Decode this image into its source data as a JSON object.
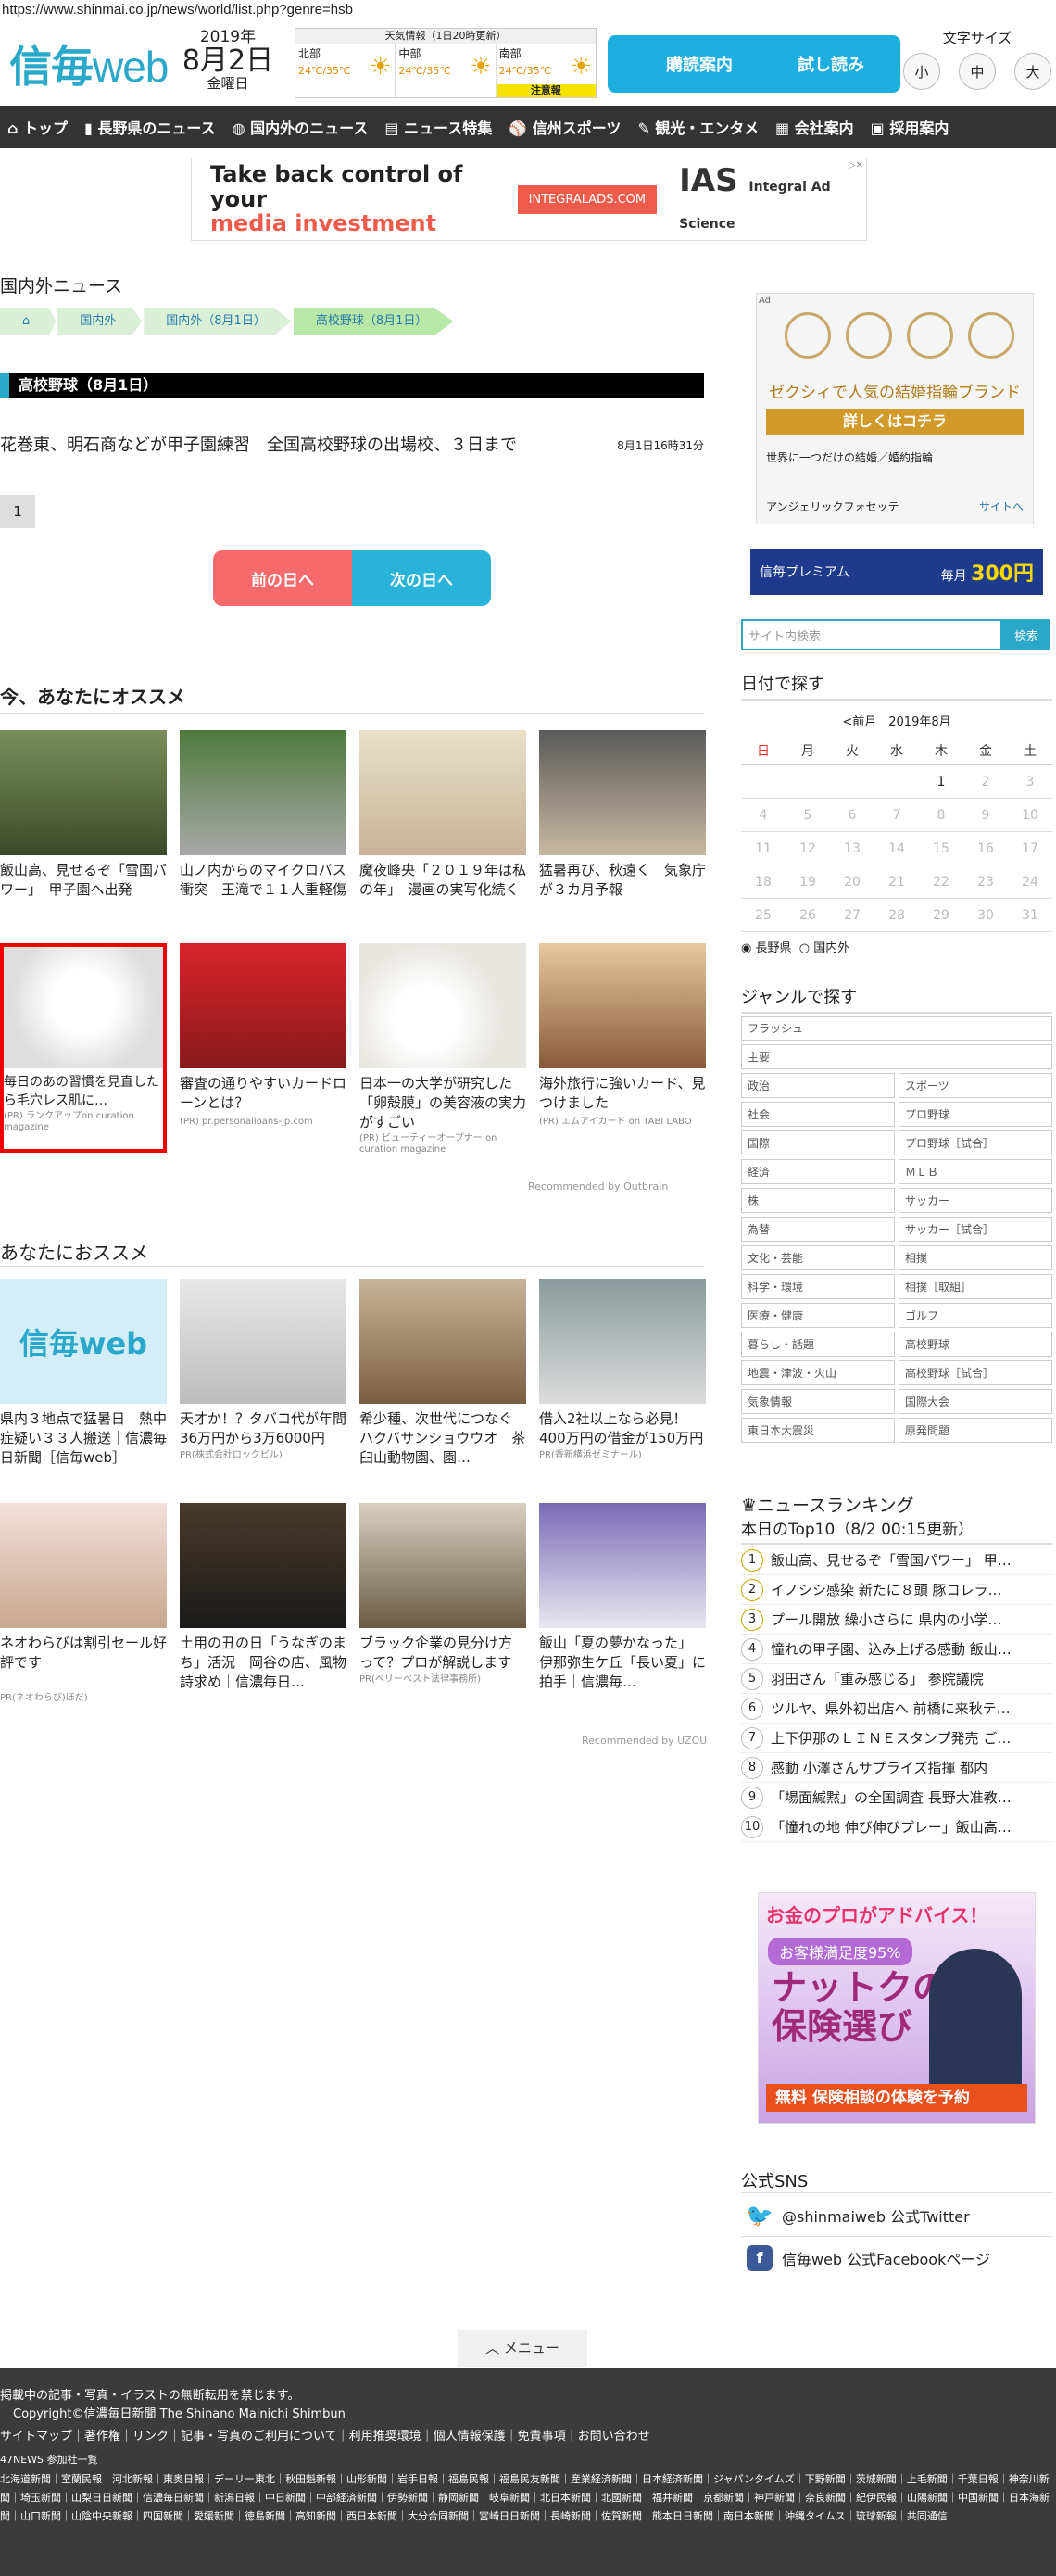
{
  "url": "https://www.shinmai.co.jp/news/world/list.php?genre=hsb",
  "header": {
    "logo_a": "信毎",
    "logo_b": "web",
    "year": "2019年",
    "day": "8月2日",
    "weekday": "金曜日",
    "weather_title": "天気情報（1日20時更新）",
    "regions": [
      {
        "name": "北部",
        "temp": "24℃/35℃"
      },
      {
        "name": "中部",
        "temp": "24℃/35℃"
      },
      {
        "name": "南部",
        "temp": "24℃/35℃"
      }
    ],
    "warn": "注意報",
    "subscribe": "購読案内",
    "trial": "試し読み",
    "fontsize_label": "文字サイズ",
    "fontsize": [
      "小",
      "中",
      "大"
    ]
  },
  "nav": [
    "トップ",
    "長野県のニュース",
    "国内外のニュース",
    "ニュース特集",
    "信州スポーツ",
    "観光・エンタメ",
    "会社案内",
    "採用案内"
  ],
  "ad_top": {
    "line1": "Take back control of your",
    "line2": "media investment",
    "btn": "INTEGRALADS.COM",
    "brand": "IAS",
    "brand_sub": "Integral Ad Science"
  },
  "section_title": "国内外ニュース",
  "breadcrumb": [
    "国内外",
    "国内外（8月1日）",
    "高校野球（8月1日）"
  ],
  "heading": "高校野球（8月1日）",
  "article": {
    "title": "花巻東、明石商などが甲子園練習　全国高校野球の出場校、３日まで",
    "date": "8月1日16時31分"
  },
  "page_num": "1",
  "prev_day": "前の日へ",
  "next_day": "次の日へ",
  "rec1_title": "今、あなたにオススメ",
  "rec1": [
    {
      "cap": "飯山高、見せるぞ「雪国パワー」　甲子園へ出発",
      "pr": ""
    },
    {
      "cap": "山ノ内からのマイクロバス衝突　王滝で１１人重軽傷",
      "pr": ""
    },
    {
      "cap": "魔夜峰央「２０１９年は私の年」　漫画の実写化続く",
      "pr": ""
    },
    {
      "cap": "猛暑再び、秋遠く　気象庁が３カ月予報",
      "pr": ""
    },
    {
      "cap": "毎日のあの習慣を見直したら毛穴レス肌に…",
      "pr": "(PR) ランクアップon curation magazine"
    },
    {
      "cap": "審査の通りやすいカードローンとは？",
      "pr": "(PR) pr.personalloans-jp.com"
    },
    {
      "cap": "日本一の大学が研究した「卵殻膜」の美容液の実力がすごい",
      "pr": "(PR) ビューティーオープナー on curation magazine"
    },
    {
      "cap": "海外旅行に強いカード、見つけました",
      "pr": "(PR) エムアイカード on TABI LABO"
    }
  ],
  "outbrain": "Recommended by Outbrain",
  "rec2_title": "あなたにおススメ",
  "rec2": [
    {
      "cap": "県内３地点で猛暑日　熱中症疑い３３人搬送｜信濃毎日新聞［信毎web］",
      "pr": ""
    },
    {
      "cap": "天才か！？タバコ代が年間36万円から3万6000円に！",
      "pr": "PR(株式会社ロックビル)"
    },
    {
      "cap": "希少種、次世代につなぐ　ハクバサンショウウオ　茶臼山動物園、園…",
      "pr": ""
    },
    {
      "cap": "借入2社以上なら必見！400万円の借金が150万円に!?",
      "pr": "PR(香新横浜ゼミナール)"
    },
    {
      "cap": "ネオわらびは割引セール好評です",
      "pr": "PR(ネオわらび)ほだ)"
    },
    {
      "cap": "土用の丑の日「うなぎのまち」活況　岡谷の店、風物詩求め｜信濃毎日…",
      "pr": ""
    },
    {
      "cap": "ブラック企業の見分け方って？プロが解説します",
      "pr": "PR(ベリーベスト法律事務所)"
    },
    {
      "cap": "飯山「夏の夢かなった」　伊那弥生ケ丘「長い夏」に拍手｜信濃毎…",
      "pr": ""
    }
  ],
  "uzou": "Recommended by UZOU",
  "side_ad": {
    "t1": "ゼクシィで人気の結婚指輪ブランド",
    "t2": "詳しくはコチラ",
    "t3": "世界に一つだけの結婚／婚約指輪",
    "t4": "アンジェリックフォセッテ",
    "t5": "サイトへ",
    "label": "Ad"
  },
  "side_ad2": {
    "l": "信毎プレミアム",
    "m": "毎月",
    "r": "300円"
  },
  "search_placeholder": "サイト内検索",
  "search_btn": "検索",
  "cal_title": "日付で探す",
  "cal_month": "<前月　2019年8月",
  "dow": [
    "日",
    "月",
    "火",
    "水",
    "木",
    "金",
    "土"
  ],
  "weeks": [
    [
      "",
      "",
      "",
      "",
      "1",
      "2",
      "3"
    ],
    [
      "4",
      "5",
      "6",
      "7",
      "8",
      "9",
      "10"
    ],
    [
      "11",
      "12",
      "13",
      "14",
      "15",
      "16",
      "17"
    ],
    [
      "18",
      "19",
      "20",
      "21",
      "22",
      "23",
      "24"
    ],
    [
      "25",
      "26",
      "27",
      "28",
      "29",
      "30",
      "31"
    ]
  ],
  "cal_radio": [
    "長野県",
    "国内外"
  ],
  "genre_title": "ジャンルで探す",
  "genres_wide": [
    "フラッシュ",
    "主要"
  ],
  "genres": [
    "政治",
    "スポーツ",
    "社会",
    "プロ野球",
    "国際",
    "プロ野球［試合］",
    "経済",
    "ＭＬＢ",
    "株",
    "サッカー",
    "為替",
    "サッカー［試合］",
    "文化・芸能",
    "相撲",
    "科学・環境",
    "相撲［取組］",
    "医療・健康",
    "ゴルフ",
    "暮らし・話題",
    "高校野球",
    "地震・津波・火山",
    "高校野球［試合］",
    "気象情報",
    "国際大会",
    "東日本大震災",
    "原発問題"
  ],
  "rank_title": "ニュースランキング",
  "rank_sub": "本日のTop10（8/2 00:15更新）",
  "ranking": [
    "飯山高、見せるぞ「雪国パワー」 甲…",
    "イノシシ感染 新たに８頭 豚コレラ…",
    "プール開放 繰小さらに 県内の小学…",
    "憧れの甲子園、込み上げる感動 飯山…",
    "羽田さん「重み感じる」 参院議院",
    "ツルヤ、県外初出店へ 前橋に来秋テ…",
    "上下伊那のＬＩＮＥスタンプ発売 ご…",
    "感動 小澤さんサプライズ指揮 都内",
    "「場面緘黙」の全国調査 長野大准教…",
    "「憧れの地 伸び伸びプレー」飯山高…"
  ],
  "side_ad3": {
    "a": "お金のプロがアドバイス！",
    "b": "お客様満足度95%",
    "c1": "ナットクの",
    "c2": "保険選び",
    "d": "無料 保険相談の体験を予約"
  },
  "sns_title": "公式SNS",
  "sns": [
    "@shinmaiweb 公式Twitter",
    "信毎web 公式Facebookページ"
  ],
  "menu": "メニュー",
  "footer": {
    "l1": "掲載中の記事・写真・イラストの無断転用を禁じます。",
    "l2": "Copyright©信濃毎日新聞 The Shinano Mainichi Shimbun",
    "links": "サイトマップ｜著作権｜リンク｜記事・写真のご利用について｜利用推奨環境｜個人情報保護｜免責事項｜お問い合わせ",
    "papers_title": "47NEWS 参加社一覧",
    "papers": "北海道新聞｜室蘭民報｜河北新報｜東奥日報｜デーリー東北｜秋田魁新報｜山形新聞｜岩手日報｜福島民報｜福島民友新聞｜産業経済新聞｜日本経済新聞｜ジャパンタイムズ｜下野新聞｜茨城新聞｜上毛新聞｜千葉日報｜神奈川新聞｜埼玉新聞｜山梨日日新聞｜信濃毎日新聞｜新潟日報｜中日新聞｜中部経済新聞｜伊勢新聞｜静岡新聞｜岐阜新聞｜北日本新聞｜北國新聞｜福井新聞｜京都新聞｜神戸新聞｜奈良新聞｜紀伊民報｜山陽新聞｜中国新聞｜日本海新聞｜山口新聞｜山陰中央新報｜四国新聞｜愛媛新聞｜徳島新聞｜高知新聞｜西日本新聞｜大分合同新聞｜宮崎日日新聞｜長崎新聞｜佐賀新聞｜熊本日日新聞｜南日本新聞｜沖縄タイムス｜琉球新報｜共同通信"
  }
}
